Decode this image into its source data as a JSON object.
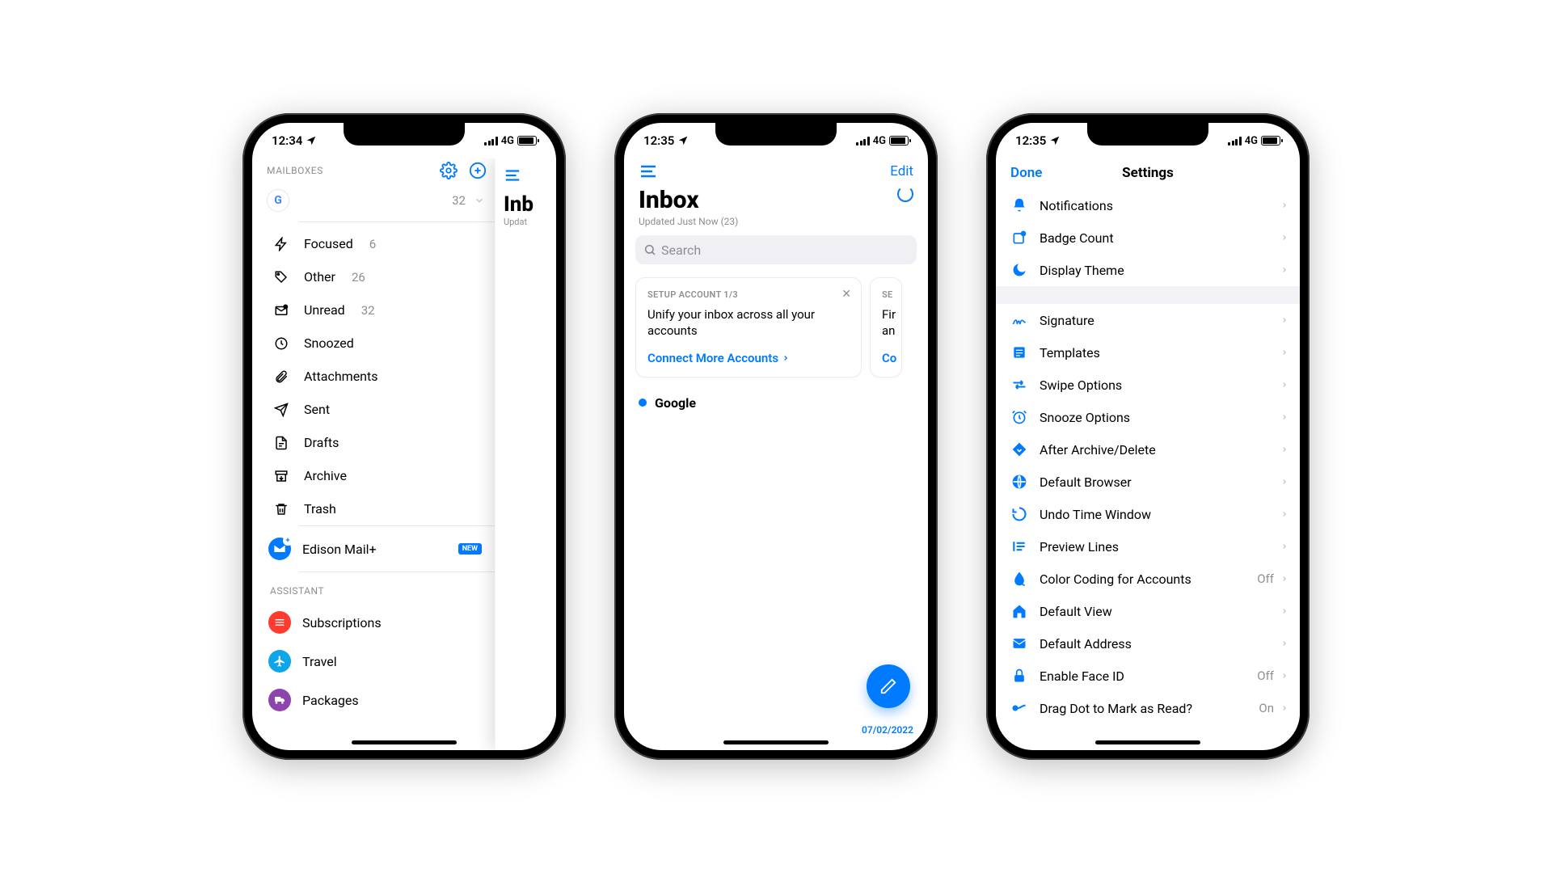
{
  "status": {
    "time1": "12:34",
    "time2": "12:35",
    "time3": "12:35",
    "net": "4G"
  },
  "phone1": {
    "sidebar": {
      "header": "MAILBOXES",
      "account_count": "32",
      "folders": [
        {
          "icon": "bolt",
          "label": "Focused",
          "count": "6"
        },
        {
          "icon": "tag",
          "label": "Other",
          "count": "26"
        },
        {
          "icon": "envelope",
          "label": "Unread",
          "count": "32"
        },
        {
          "icon": "clock",
          "label": "Snoozed",
          "count": ""
        },
        {
          "icon": "paperclip",
          "label": "Attachments",
          "count": ""
        },
        {
          "icon": "plane",
          "label": "Sent",
          "count": ""
        },
        {
          "icon": "doc",
          "label": "Drafts",
          "count": ""
        },
        {
          "icon": "archive",
          "label": "Archive",
          "count": ""
        },
        {
          "icon": "trash",
          "label": "Trash",
          "count": ""
        }
      ],
      "edison": {
        "label": "Edison Mail+",
        "badge": "NEW"
      },
      "assistant_header": "ASSISTANT",
      "assistant": [
        {
          "color": "#ff3b30",
          "icon": "list",
          "label": "Subscriptions"
        },
        {
          "color": "#0ea5e9",
          "icon": "plane-solid",
          "label": "Travel"
        },
        {
          "color": "#8e44ad",
          "icon": "truck",
          "label": "Packages"
        }
      ]
    },
    "peek": {
      "title": "Inb",
      "subtitle": "Updat"
    }
  },
  "phone2": {
    "edit": "Edit",
    "title": "Inbox",
    "subtitle": "Updated Just Now (23)",
    "search_placeholder": "Search",
    "card": {
      "step": "SETUP ACCOUNT 1/3",
      "text": "Unify your inbox across all your accounts",
      "cta": "Connect More Accounts"
    },
    "card2": {
      "step": "SE",
      "text": "Fir\nan",
      "cta": "Co"
    },
    "account": "Google",
    "date": "07/02/2022"
  },
  "phone3": {
    "done": "Done",
    "title": "Settings",
    "group1": [
      {
        "icon": "bell",
        "label": "Notifications"
      },
      {
        "icon": "badge",
        "label": "Badge Count"
      },
      {
        "icon": "moon",
        "label": "Display Theme"
      }
    ],
    "group2": [
      {
        "icon": "signature",
        "label": "Signature"
      },
      {
        "icon": "templates",
        "label": "Templates"
      },
      {
        "icon": "swipe",
        "label": "Swipe Options"
      },
      {
        "icon": "alarm",
        "label": "Snooze Options"
      },
      {
        "icon": "diamond",
        "label": "After Archive/Delete"
      },
      {
        "icon": "globe",
        "label": "Default Browser"
      },
      {
        "icon": "undo",
        "label": "Undo Time Window"
      },
      {
        "icon": "lines",
        "label": "Preview Lines"
      },
      {
        "icon": "droplet",
        "label": "Color Coding for Accounts",
        "val": "Off"
      },
      {
        "icon": "home",
        "label": "Default View"
      },
      {
        "icon": "mail",
        "label": "Default Address"
      },
      {
        "icon": "lock",
        "label": "Enable Face ID",
        "val": "Off"
      },
      {
        "icon": "dragdot",
        "label": "Drag Dot to Mark as Read?",
        "val": "On"
      }
    ]
  }
}
